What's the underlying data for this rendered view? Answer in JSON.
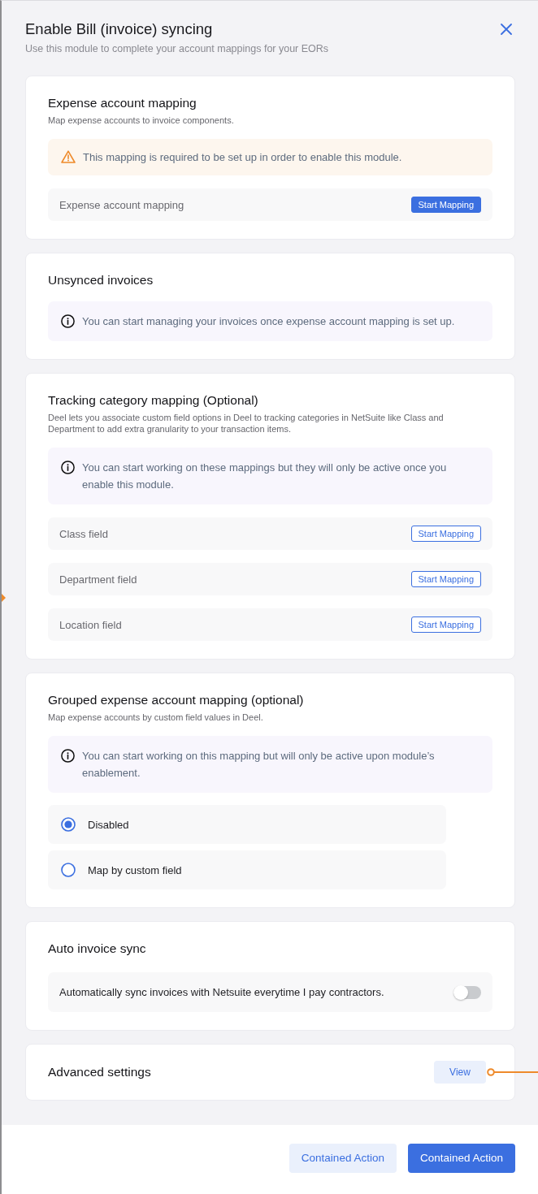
{
  "dialog": {
    "title": "Enable Bill (invoice) syncing",
    "subtitle": "Use this module to complete your account mappings for your EORs"
  },
  "sections": [
    {
      "kind": "stacked",
      "title": "Expense account mapping",
      "description": "Map expense accounts to invoice components.",
      "notice": {
        "kind": "warning",
        "text": "This mapping is required to be set up in order to enable this module."
      },
      "rows": [
        {
          "label": "Expense account mapping",
          "button": {
            "label": "Start Mapping",
            "kind": "primary"
          }
        }
      ]
    },
    {
      "kind": "stacked",
      "title": "Unsynced invoices",
      "notice": {
        "kind": "info",
        "text": "You can start managing your invoices once expense account mapping is set up."
      }
    },
    {
      "kind": "stacked",
      "title": "Tracking category mapping (Optional)",
      "description": "Deel lets you associate custom field options in Deel to tracking categories in NetSuite like Class and Department to add extra granularity to your transaction items.",
      "notice": {
        "kind": "info",
        "text": "You can start working on these mappings but they will only be active once you enable this module."
      },
      "rows": [
        {
          "label": "Class field",
          "button": {
            "label": "Start Mapping",
            "kind": "secondary"
          }
        },
        {
          "label": "Department field",
          "button": {
            "label": "Start Mapping",
            "kind": "secondary"
          }
        },
        {
          "label": "Location field",
          "button": {
            "label": "Start Mapping",
            "kind": "secondary"
          }
        }
      ]
    },
    {
      "kind": "stacked",
      "title": "Grouped expense account mapping (optional)",
      "description": "Map expense accounts by custom field values in Deel.",
      "notice": {
        "kind": "info",
        "text": "You can start working on this mapping but will only be active upon module’s enablement."
      },
      "options": [
        {
          "label": "Disabled",
          "selected": true
        },
        {
          "label": "Map by custom field",
          "selected": false
        }
      ]
    },
    {
      "kind": "stacked",
      "title": "Auto invoice sync",
      "toggles": [
        {
          "label": "Automatically sync invoices with Netsuite everytime I pay contractors.",
          "on": false
        }
      ]
    },
    {
      "kind": "inline",
      "title": "Advanced settings",
      "action": {
        "label": "View"
      }
    }
  ],
  "footer": {
    "buttons": [
      {
        "label": "Contained Action",
        "kind": "secondary"
      },
      {
        "label": "Contained Action",
        "kind": "primary"
      }
    ]
  }
}
